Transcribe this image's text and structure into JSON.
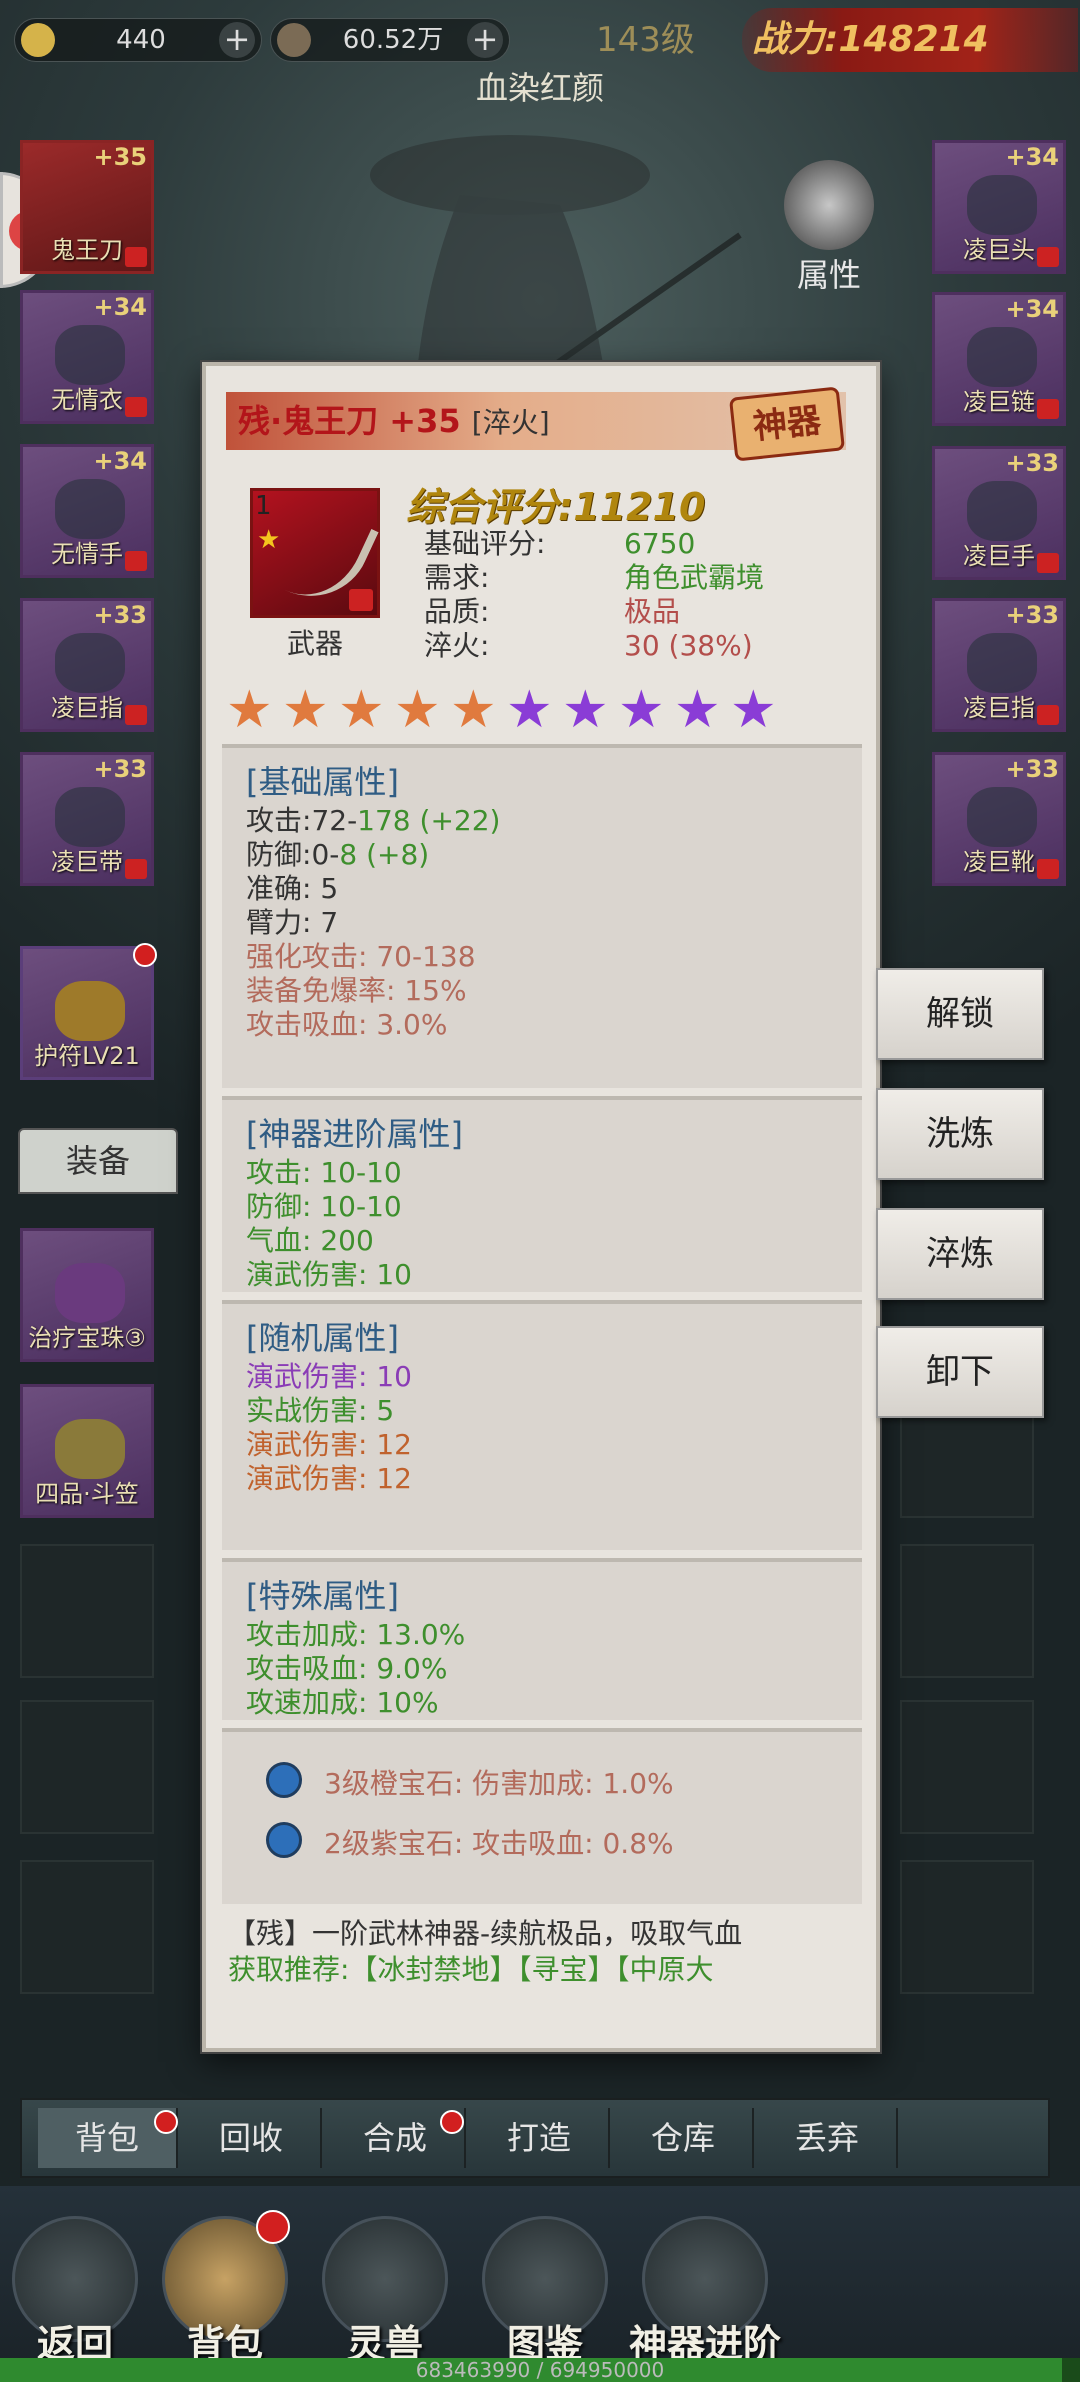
{
  "top": {
    "gold": "440",
    "silver": "60.52万",
    "level": "143级",
    "power_label": "战力",
    "power_value": "148214",
    "char_name": "血染红颜"
  },
  "slots_left": [
    {
      "plus": "+35",
      "name": "鬼王刀"
    },
    {
      "plus": "+34",
      "name": "无情衣"
    },
    {
      "plus": "+34",
      "name": "无情手"
    },
    {
      "plus": "+33",
      "name": "凌巨指"
    },
    {
      "plus": "+33",
      "name": "凌巨带"
    }
  ],
  "slots_right": [
    {
      "plus": "+34",
      "name": "凌巨头"
    },
    {
      "plus": "+34",
      "name": "凌巨链"
    },
    {
      "plus": "+33",
      "name": "凌巨手"
    },
    {
      "plus": "+33",
      "name": "凌巨指"
    },
    {
      "plus": "+33",
      "name": "凌巨靴"
    }
  ],
  "side_labels": {
    "attr": "属性"
  },
  "amulet": "护符LV21",
  "bag_tab": "装备",
  "bag_items": [
    {
      "name": "治疗宝珠③"
    },
    {
      "name": "四品·斗笠"
    }
  ],
  "panel": {
    "title": "残·鬼王刀 +35",
    "tag": "[淬火]",
    "stamp": "神器",
    "item_num": "1",
    "category": "武器",
    "score_label": "综合评分:",
    "score_value": "11210",
    "base_rows": [
      {
        "label": "基础评分:",
        "value": "6750"
      },
      {
        "label": "需求:",
        "value": "角色武霸境"
      },
      {
        "label": "品质:",
        "value": "极品"
      },
      {
        "label": "淬火:",
        "value": "30 (38%)"
      }
    ],
    "stars": {
      "orange": 5,
      "purple": 5,
      "filled_fraction": 1.0
    },
    "basic": {
      "header": "[基础属性]",
      "atk_label": "攻击:",
      "atk_base": "72-",
      "atk_val": "178 (+22)",
      "def_label": "防御:",
      "def_base": "0-",
      "def_val": "8 (+8)",
      "acc": "准确: 5",
      "arm": "臂力: 7",
      "enh_atk": "强化攻击: 70-138",
      "crit_res": "装备免爆率: 15%",
      "lifesteal": "攻击吸血: 3.0%"
    },
    "advanced": {
      "header": "[神器进阶属性]",
      "lines": [
        "攻击: 10-10",
        "防御: 10-10",
        "气血: 200",
        "演武伤害: 10"
      ]
    },
    "random": {
      "header": "[随机属性]",
      "line1": "演武伤害: 10",
      "line2": "实战伤害: 5",
      "line3": "演武伤害: 12",
      "line4": "演武伤害: 12"
    },
    "special": {
      "header": "[特殊属性]",
      "lines": [
        "攻击加成: 13.0%",
        "攻击吸血: 9.0%",
        "攻速加成: 10%"
      ]
    },
    "gems": [
      "3级橙宝石: 伤害加成: 1.0%",
      "2级紫宝石: 攻击吸血: 0.8%"
    ],
    "desc": "【残】一阶武林神器-续航极品，吸取气血",
    "source_label": "获取推荐:",
    "sources": "【冰封禁地】【寻宝】【中原大"
  },
  "actions": [
    "解锁",
    "洗炼",
    "淬炼",
    "卸下"
  ],
  "bottom_tabs": [
    "背包",
    "回收",
    "合成",
    "打造",
    "仓库",
    "丢弃"
  ],
  "nav": [
    "返回",
    "背包",
    "灵兽",
    "图鉴",
    "神器进阶"
  ],
  "exp": {
    "text": "683463990 / 694950000",
    "fraction": 0.983
  },
  "colors": {
    "green": "#3e8f2d",
    "red": "#b34e4b",
    "purple": "#8a3cb6",
    "blue_header": "#2f5c84",
    "gold_score": "#b0860e"
  }
}
